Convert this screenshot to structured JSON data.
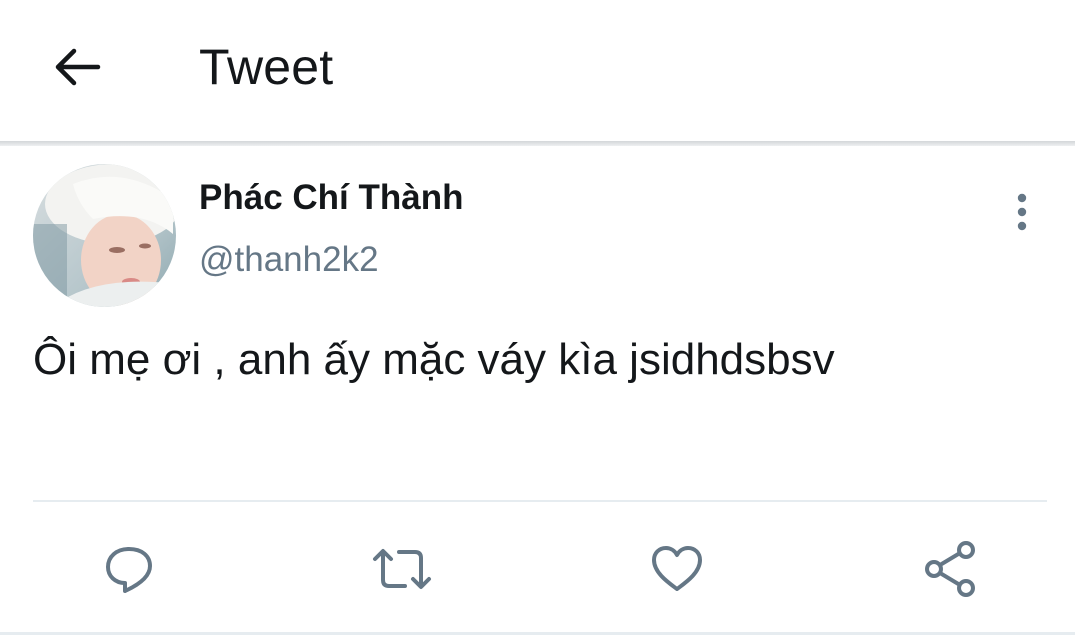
{
  "header": {
    "title": "Tweet",
    "back_icon": "arrow-left-icon"
  },
  "tweet": {
    "author": {
      "display_name": "Phác Chí Thành",
      "handle": "@thanh2k2"
    },
    "text": "Ôi mẹ ơi , anh ấy mặc váy kìa jsidhdsbsv",
    "menu_icon": "more-vertical-icon"
  },
  "actions": [
    {
      "icon": "reply-icon"
    },
    {
      "icon": "retweet-icon"
    },
    {
      "icon": "like-icon"
    },
    {
      "icon": "share-icon"
    }
  ],
  "colors": {
    "text_primary": "#14171a",
    "text_secondary": "#657786",
    "icon_gray": "#657786",
    "divider": "#e6ecf0",
    "background": "#ffffff"
  }
}
